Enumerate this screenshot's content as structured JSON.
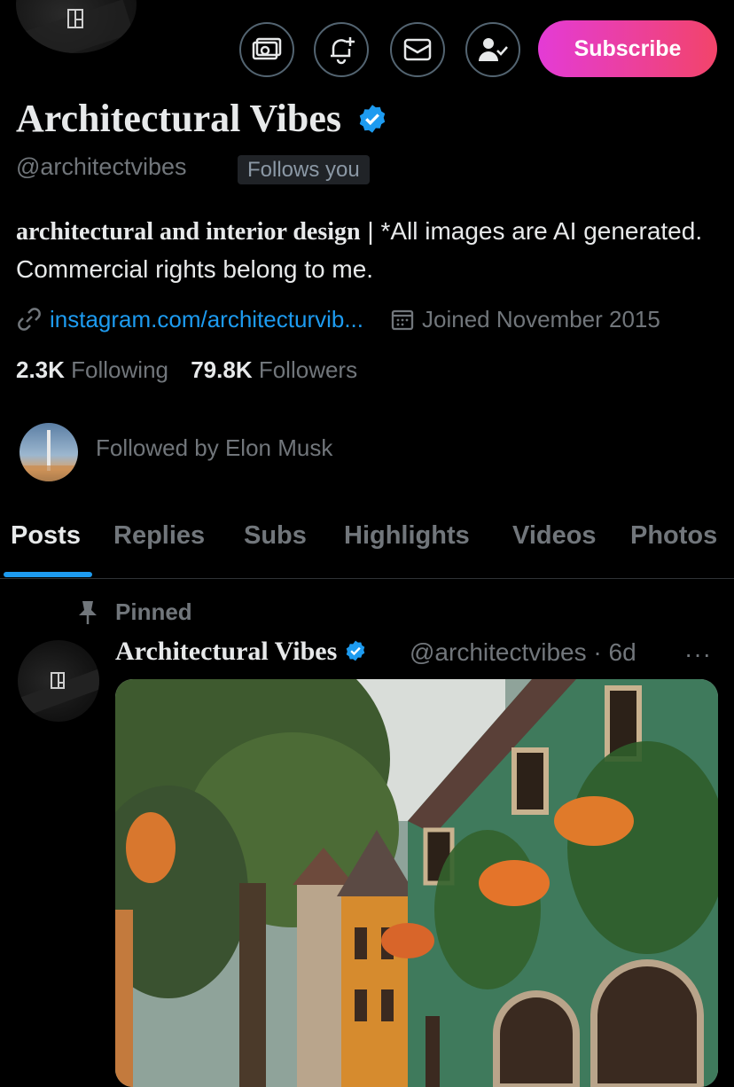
{
  "profile": {
    "display_name": "Architectural Vibes",
    "handle": "@architectvibes",
    "follows_you": "Follows you",
    "bio_bold": "architectural and interior design",
    "bio_rest": " | *All images are AI generated. Commercial rights belong to me.",
    "link": "instagram.com/architecturvib...",
    "joined": "Joined November 2015",
    "following_count": "2.3K",
    "following_label": "Following",
    "followers_count": "79.8K",
    "followers_label": "Followers",
    "followed_by": "Followed by Elon Musk"
  },
  "actions": {
    "subscribe_label": "Subscribe",
    "icons": [
      "money-icon",
      "bell-add-icon",
      "mail-icon",
      "person-check-icon"
    ]
  },
  "tabs": [
    {
      "label": "Posts",
      "active": true
    },
    {
      "label": "Replies",
      "active": false
    },
    {
      "label": "Subs",
      "active": false
    },
    {
      "label": "Highlights",
      "active": false
    },
    {
      "label": "Videos",
      "active": false
    },
    {
      "label": "Photos",
      "active": false
    }
  ],
  "post": {
    "pinned_label": "Pinned",
    "author": "Architectural Vibes",
    "handle_time": "@architectvibes · 6d",
    "more": "···"
  },
  "colors": {
    "background": "#000000",
    "accent": "#1d9bf0",
    "muted": "#71767b",
    "subscribe_gradient": [
      "#e43bd6",
      "#f2446a"
    ]
  }
}
